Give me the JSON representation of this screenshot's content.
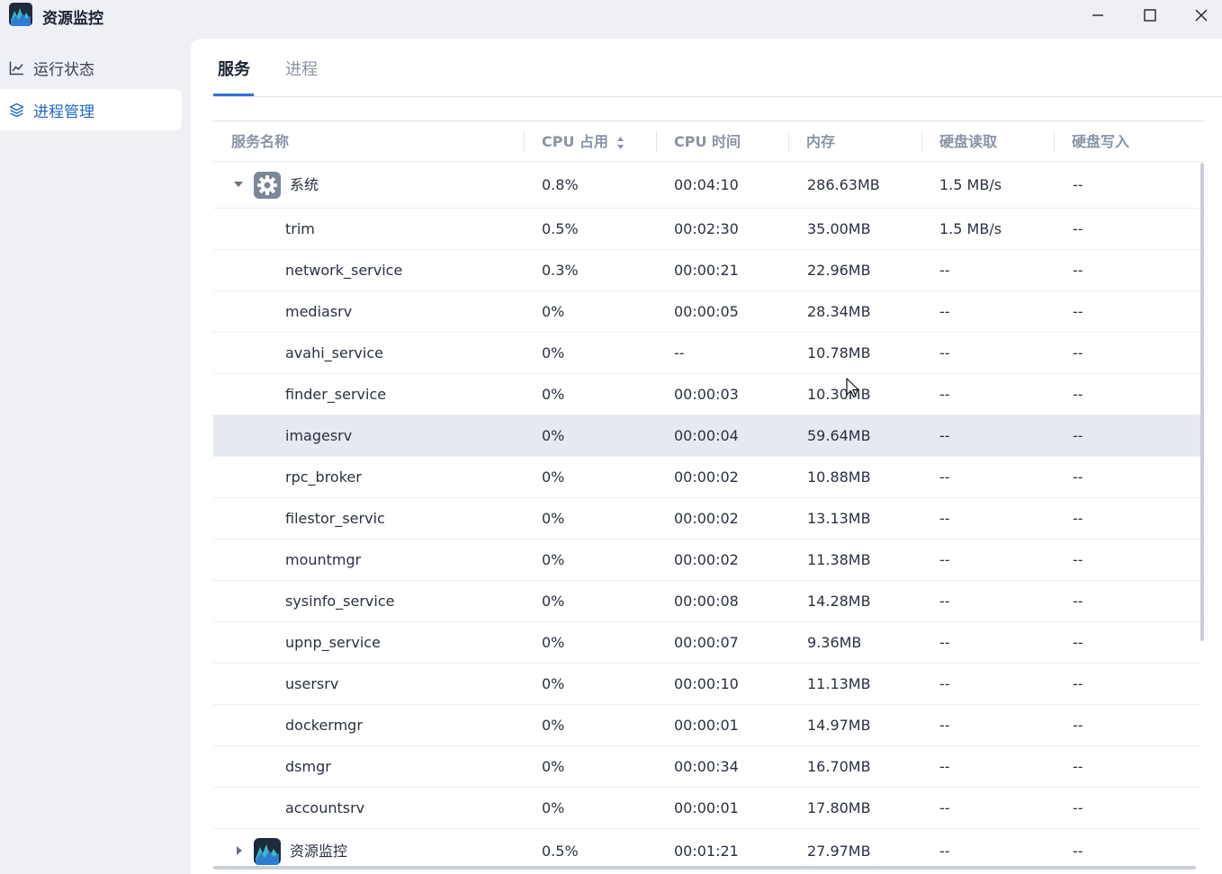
{
  "window": {
    "title": "资源监控",
    "app_icon": "resource-monitor-icon",
    "controls": [
      "minimize-icon",
      "maximize-icon",
      "close-icon"
    ]
  },
  "sidebar": {
    "items": [
      {
        "label": "运行状态",
        "icon": "line-chart-icon",
        "active": false
      },
      {
        "label": "进程管理",
        "icon": "layers-icon",
        "active": true
      }
    ]
  },
  "tabs": [
    {
      "label": "服务",
      "active": true
    },
    {
      "label": "进程",
      "active": false
    }
  ],
  "table": {
    "columns": {
      "name": "服务名称",
      "cpu": "CPU 占用",
      "cpu_time": "CPU 时间",
      "memory": "内存",
      "disk_read": "硬盘读取",
      "disk_write": "硬盘写入"
    },
    "sorted_column": "cpu",
    "rows": [
      {
        "type": "group",
        "expanded": true,
        "icon": "gear-icon",
        "name": "系统",
        "cpu": "0.8%",
        "cpu_time": "00:04:10",
        "memory": "286.63MB",
        "disk_read": "1.5 MB/s",
        "disk_write": "--"
      },
      {
        "type": "child",
        "name": "trim",
        "cpu": "0.5%",
        "cpu_time": "00:02:30",
        "memory": "35.00MB",
        "disk_read": "1.5 MB/s",
        "disk_write": "--"
      },
      {
        "type": "child",
        "name": "network_service",
        "cpu": "0.3%",
        "cpu_time": "00:00:21",
        "memory": "22.96MB",
        "disk_read": "--",
        "disk_write": "--"
      },
      {
        "type": "child",
        "name": "mediasrv",
        "cpu": "0%",
        "cpu_time": "00:00:05",
        "memory": "28.34MB",
        "disk_read": "--",
        "disk_write": "--"
      },
      {
        "type": "child",
        "name": "avahi_service",
        "cpu": "0%",
        "cpu_time": "--",
        "memory": "10.78MB",
        "disk_read": "--",
        "disk_write": "--"
      },
      {
        "type": "child",
        "name": "finder_service",
        "cpu": "0%",
        "cpu_time": "00:00:03",
        "memory": "10.30MB",
        "disk_read": "--",
        "disk_write": "--"
      },
      {
        "type": "child",
        "name": "imagesrv",
        "cpu": "0%",
        "cpu_time": "00:00:04",
        "memory": "59.64MB",
        "disk_read": "--",
        "disk_write": "--",
        "highlight": true
      },
      {
        "type": "child",
        "name": "rpc_broker",
        "cpu": "0%",
        "cpu_time": "00:00:02",
        "memory": "10.88MB",
        "disk_read": "--",
        "disk_write": "--"
      },
      {
        "type": "child",
        "name": "filestor_servic",
        "cpu": "0%",
        "cpu_time": "00:00:02",
        "memory": "13.13MB",
        "disk_read": "--",
        "disk_write": "--"
      },
      {
        "type": "child",
        "name": "mountmgr",
        "cpu": "0%",
        "cpu_time": "00:00:02",
        "memory": "11.38MB",
        "disk_read": "--",
        "disk_write": "--"
      },
      {
        "type": "child",
        "name": "sysinfo_service",
        "cpu": "0%",
        "cpu_time": "00:00:08",
        "memory": "14.28MB",
        "disk_read": "--",
        "disk_write": "--"
      },
      {
        "type": "child",
        "name": "upnp_service",
        "cpu": "0%",
        "cpu_time": "00:00:07",
        "memory": "9.36MB",
        "disk_read": "--",
        "disk_write": "--"
      },
      {
        "type": "child",
        "name": "usersrv",
        "cpu": "0%",
        "cpu_time": "00:00:10",
        "memory": "11.13MB",
        "disk_read": "--",
        "disk_write": "--"
      },
      {
        "type": "child",
        "name": "dockermgr",
        "cpu": "0%",
        "cpu_time": "00:00:01",
        "memory": "14.97MB",
        "disk_read": "--",
        "disk_write": "--"
      },
      {
        "type": "child",
        "name": "dsmgr",
        "cpu": "0%",
        "cpu_time": "00:00:34",
        "memory": "16.70MB",
        "disk_read": "--",
        "disk_write": "--"
      },
      {
        "type": "child",
        "name": "accountsrv",
        "cpu": "0%",
        "cpu_time": "00:00:01",
        "memory": "17.80MB",
        "disk_read": "--",
        "disk_write": "--"
      },
      {
        "type": "group",
        "expanded": false,
        "icon": "resource-monitor-icon",
        "name": "资源监控",
        "cpu": "0.5%",
        "cpu_time": "00:01:21",
        "memory": "27.97MB",
        "disk_read": "--",
        "disk_write": "--"
      }
    ]
  },
  "colors": {
    "accent": "#2e74d6",
    "window_bg": "#eef0f5",
    "row_highlight": "#e6e9ef"
  }
}
